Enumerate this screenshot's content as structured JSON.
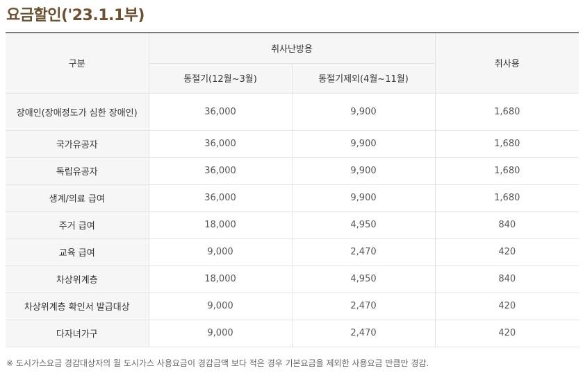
{
  "title": "요금할인('23.1.1부)",
  "table": {
    "headers": {
      "category": "구분",
      "heating_group": "취사난방용",
      "winter": "동절기(12월~3월)",
      "non_winter": "동절기제외(4월~11월)",
      "cooking": "취사용"
    },
    "rows": [
      {
        "label": "장애인(장애정도가 심한 장애인)",
        "winter": "36,000",
        "non_winter": "9,900",
        "cooking": "1,680"
      },
      {
        "label": "국가유공자",
        "winter": "36,000",
        "non_winter": "9,900",
        "cooking": "1,680"
      },
      {
        "label": "독립유공자",
        "winter": "36,000",
        "non_winter": "9,900",
        "cooking": "1,680"
      },
      {
        "label": "생계/의료 급여",
        "winter": "36,000",
        "non_winter": "9,900",
        "cooking": "1,680"
      },
      {
        "label": "주거 급여",
        "winter": "18,000",
        "non_winter": "4,950",
        "cooking": "840"
      },
      {
        "label": "교육 급여",
        "winter": "9,000",
        "non_winter": "2,470",
        "cooking": "420"
      },
      {
        "label": "차상위계층",
        "winter": "18,000",
        "non_winter": "4,950",
        "cooking": "840"
      },
      {
        "label": "차상위계층 확인서 발급대상",
        "winter": "9,000",
        "non_winter": "2,470",
        "cooking": "420"
      },
      {
        "label": "다자녀가구",
        "winter": "9,000",
        "non_winter": "2,470",
        "cooking": "420"
      }
    ]
  },
  "note": "※ 도시가스요금 경감대상자의 월 도시가스 사용요금이 경감금액 보다 적은 경우 기본요금을 제외한 사용요금 만큼만 경감."
}
